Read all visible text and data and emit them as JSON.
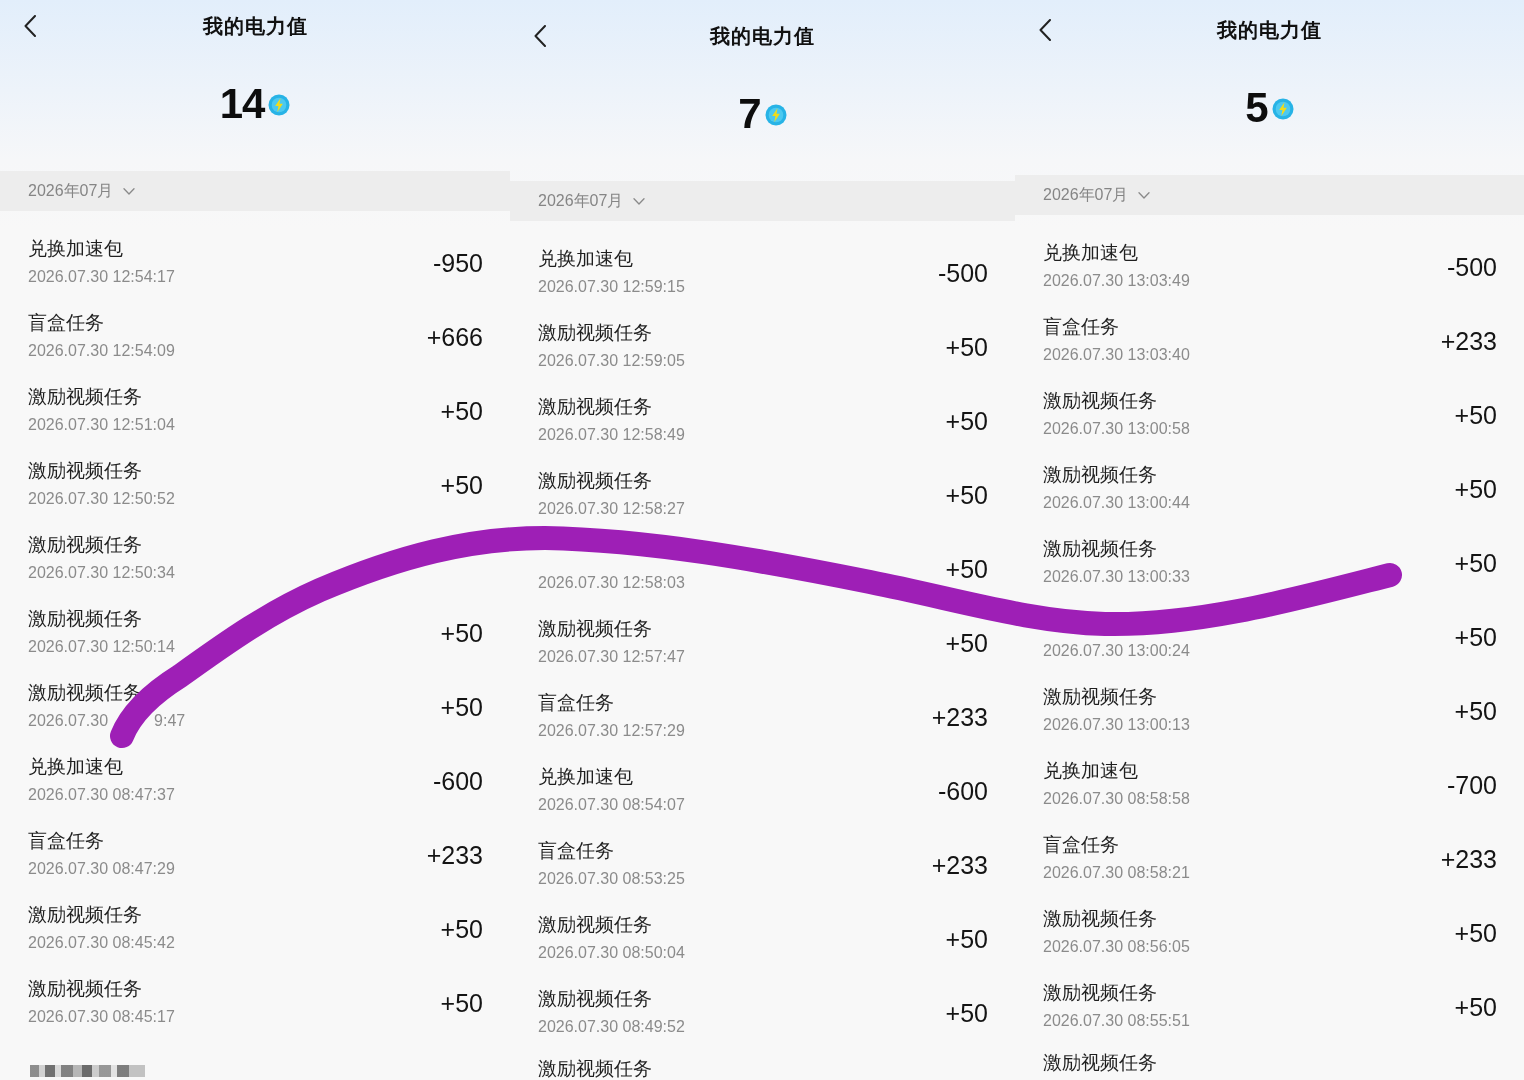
{
  "panels": [
    {
      "title": "我的电力值",
      "balance": "14",
      "month": "2026年07月",
      "records": [
        {
          "kind": "entry",
          "title": "兑换加速包",
          "date": "2026.07.30 12:54:17",
          "amount": "-950"
        },
        {
          "kind": "entry",
          "title": "盲盒任务",
          "date": "2026.07.30 12:54:09",
          "amount": "+666"
        },
        {
          "kind": "entry",
          "title": "激励视频任务",
          "date": "2026.07.30 12:51:04",
          "amount": "+50"
        },
        {
          "kind": "entry",
          "title": "激励视频任务",
          "date": "2026.07.30 12:50:52",
          "amount": "+50"
        },
        {
          "kind": "entry",
          "title": "激励视频任务",
          "date": "2026.07.30 12:50:34"
        },
        {
          "kind": "entry",
          "title": "激励视频任务",
          "date": "2026.07.30 12:50:14",
          "amount": "+50"
        },
        {
          "kind": "entry",
          "title": "激励视频任务",
          "date_fragments": [
            "2026.07.30",
            "9:47"
          ],
          "amount": "+50"
        },
        {
          "kind": "entry",
          "title": "兑换加速包",
          "date": "2026.07.30 08:47:37",
          "amount": "-600"
        },
        {
          "kind": "entry",
          "title": "盲盒任务",
          "date": "2026.07.30 08:47:29",
          "amount": "+233"
        },
        {
          "kind": "entry",
          "title": "激励视频任务",
          "date": "2026.07.30 08:45:42",
          "amount": "+50"
        },
        {
          "kind": "entry",
          "title": "激励视频任务",
          "date": "2026.07.30 08:45:17",
          "amount": "+50"
        },
        {
          "kind": "mosaic"
        }
      ]
    },
    {
      "title": "我的电力值",
      "balance": "7",
      "month": "2026年07月",
      "records": [
        {
          "kind": "entry",
          "title": "兑换加速包",
          "date": "2026.07.30 12:59:15",
          "amount": "-500"
        },
        {
          "kind": "entry",
          "title": "激励视频任务",
          "date": "2026.07.30 12:59:05",
          "amount": "+50"
        },
        {
          "kind": "entry",
          "title": "激励视频任务",
          "date": "2026.07.30 12:58:49",
          "amount": "+50"
        },
        {
          "kind": "entry",
          "title": "激励视频任务",
          "date": "2026.07.30 12:58:27",
          "amount": "+50"
        },
        {
          "kind": "entry",
          "date": "2026.07.30 12:58:03",
          "amount": "+50"
        },
        {
          "kind": "entry",
          "title": "激励视频任务",
          "date": "2026.07.30 12:57:47",
          "amount": "+50"
        },
        {
          "kind": "entry",
          "title": "盲盒任务",
          "date": "2026.07.30 12:57:29",
          "amount": "+233"
        },
        {
          "kind": "entry",
          "title": "兑换加速包",
          "date": "2026.07.30 08:54:07",
          "amount": "-600"
        },
        {
          "kind": "entry",
          "title": "盲盒任务",
          "date": "2026.07.30 08:53:25",
          "amount": "+233"
        },
        {
          "kind": "entry",
          "title": "激励视频任务",
          "date": "2026.07.30 08:50:04",
          "amount": "+50"
        },
        {
          "kind": "entry",
          "title": "激励视频任务",
          "date": "2026.07.30 08:49:52",
          "amount": "+50"
        },
        {
          "kind": "entry",
          "title": "激励视频任务"
        }
      ]
    },
    {
      "title": "我的电力值",
      "balance": "5",
      "month": "2026年07月",
      "records": [
        {
          "kind": "entry",
          "title": "兑换加速包",
          "date": "2026.07.30 13:03:49",
          "amount": "-500"
        },
        {
          "kind": "entry",
          "title": "盲盒任务",
          "date": "2026.07.30 13:03:40",
          "amount": "+233"
        },
        {
          "kind": "entry",
          "title": "激励视频任务",
          "date": "2026.07.30 13:00:58",
          "amount": "+50"
        },
        {
          "kind": "entry",
          "title": "激励视频任务",
          "date": "2026.07.30 13:00:44",
          "amount": "+50"
        },
        {
          "kind": "entry",
          "title": "激励视频任务",
          "date": "2026.07.30 13:00:33",
          "amount": "+50"
        },
        {
          "kind": "entry",
          "date": "2026.07.30 13:00:24",
          "amount": "+50"
        },
        {
          "kind": "entry",
          "title": "激励视频任务",
          "date": "2026.07.30 13:00:13",
          "amount": "+50"
        },
        {
          "kind": "entry",
          "title": "兑换加速包",
          "date": "2026.07.30 08:58:58",
          "amount": "-700"
        },
        {
          "kind": "entry",
          "title": "盲盒任务",
          "date": "2026.07.30 08:58:21",
          "amount": "+233"
        },
        {
          "kind": "entry",
          "title": "激励视频任务",
          "date": "2026.07.30 08:56:05",
          "amount": "+50"
        },
        {
          "kind": "entry",
          "title": "激励视频任务",
          "date": "2026.07.30 08:55:51",
          "amount": "+50"
        },
        {
          "kind": "entry",
          "title": "激励视频任务"
        }
      ]
    }
  ]
}
